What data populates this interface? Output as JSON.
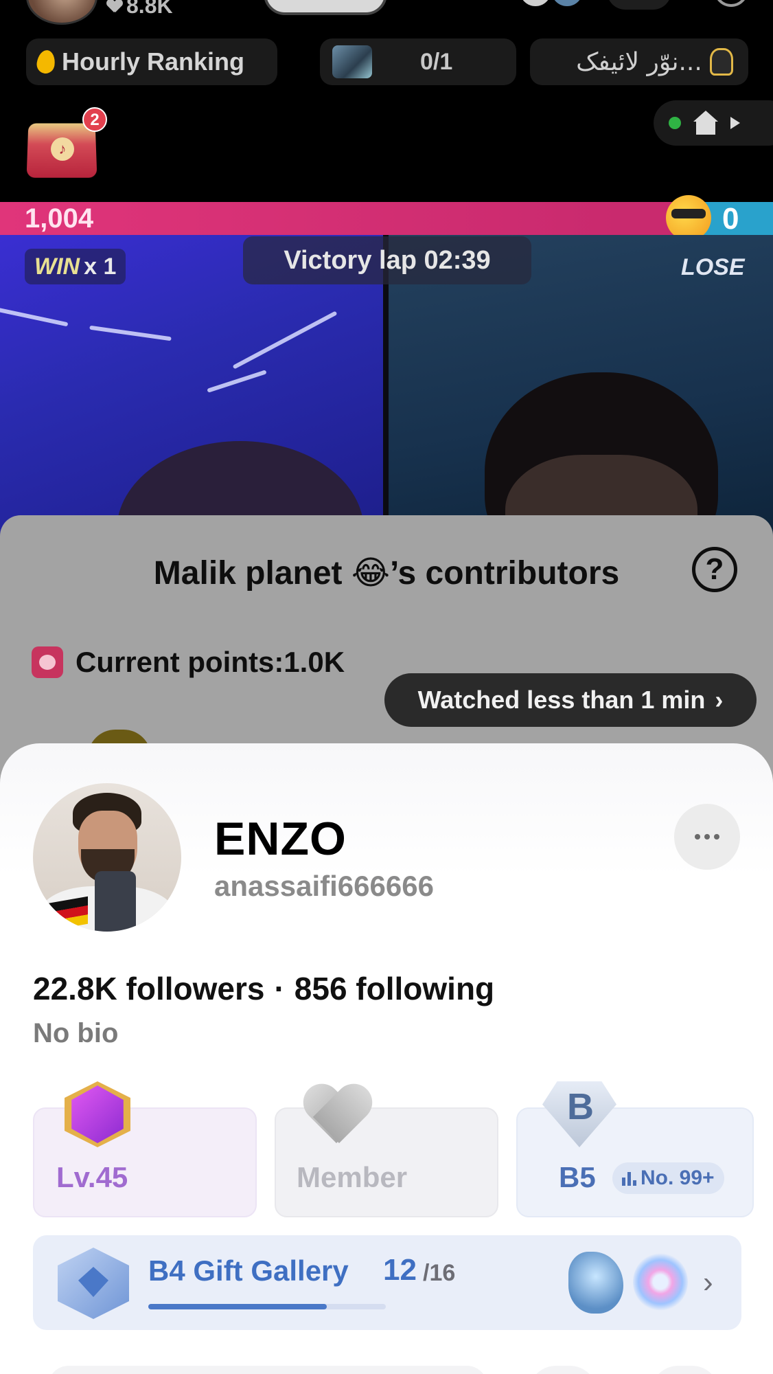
{
  "top_bar": {
    "likes": "8.8K"
  },
  "ranking_row": {
    "hourly_ranking": "Hourly Ranking",
    "gift_progress": "0/1",
    "urdu_label": "نوّر لائیفک..."
  },
  "gift_chest": {
    "badge_count": "2"
  },
  "battle": {
    "left_score": "1,004",
    "right_score": "0",
    "win_word": "WIN",
    "win_multiplier": "x 1",
    "victory_lap": "Victory lap  02:39",
    "lose_label": "LOSE",
    "colors": {
      "left": "#e0357a",
      "right": "#29a2cc"
    }
  },
  "contributors": {
    "title": "Malik planet 😂’s contributors",
    "help": "?",
    "current_points": "Current points:1.0K",
    "watched_pill": "Watched less than 1 min",
    "watched_chevron": "›"
  },
  "profile": {
    "display_name": "ENZO",
    "username": "anassaifi666666",
    "followers": "22.8K followers",
    "separator": "·",
    "following": "856 following",
    "bio": "No bio",
    "badges": {
      "level": "Lv.45",
      "member": "Member",
      "rank_tier": "B5",
      "rank_letter": "B",
      "rank_number": "No. 99+"
    },
    "gallery": {
      "title": "B4 Gift Gallery",
      "count": "12",
      "total": "/16",
      "progress_fraction": 0.75,
      "chevron": "›"
    }
  },
  "icons": {
    "flame": "flame-icon",
    "heart": "heart-icon",
    "help": "help-icon",
    "alarm": "alarm-clock-icon",
    "more": "more-dots-icon",
    "bars": "bar-chart-icon",
    "house": "house-icon"
  }
}
